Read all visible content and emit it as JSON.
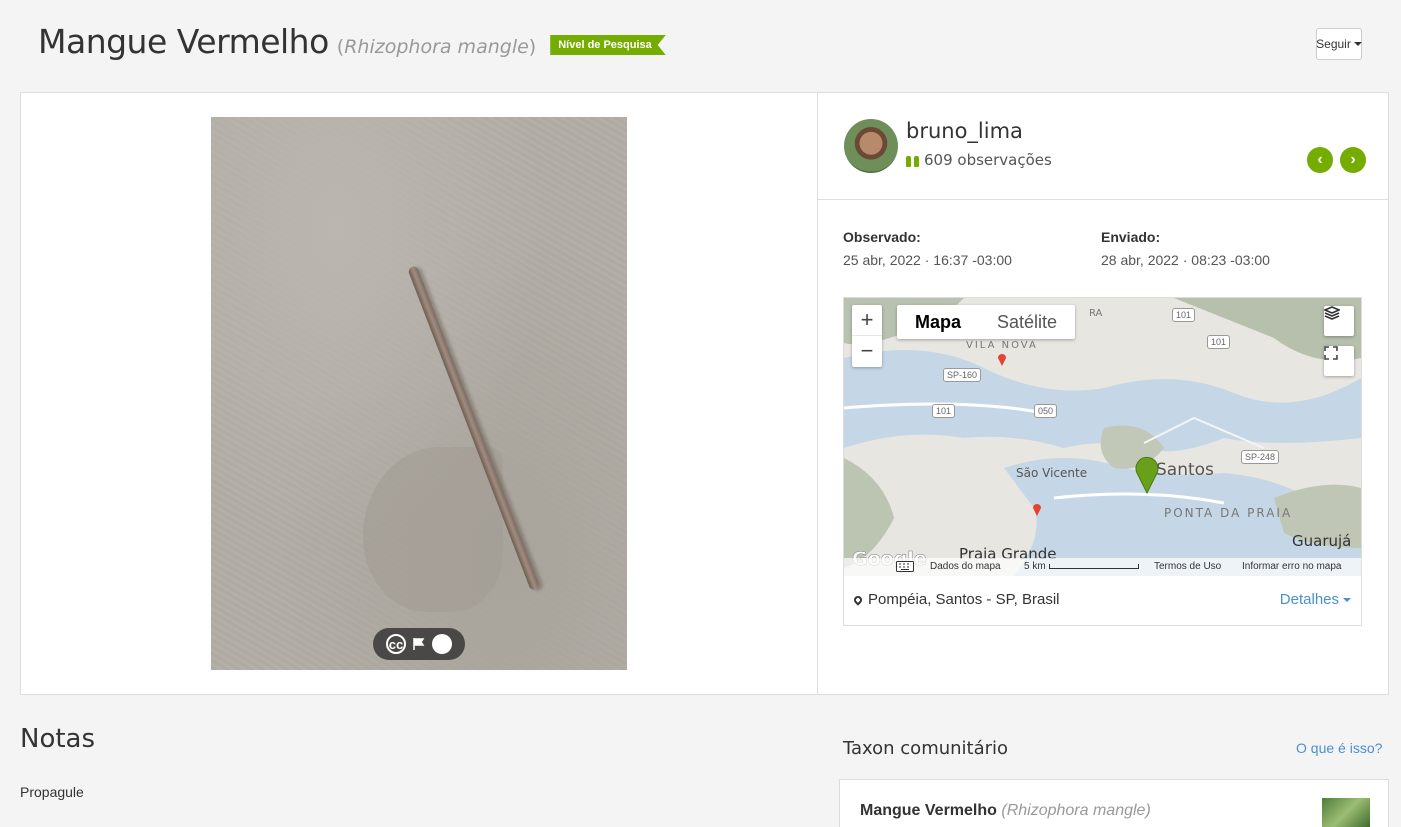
{
  "header": {
    "common_name": "Mangue Vermelho",
    "scientific_open": "(",
    "scientific_name": "Rhizophora mangle",
    "scientific_close": ")",
    "quality_badge": "Nível de Pesquisa",
    "follow_label": "Seguir"
  },
  "photo": {
    "icons": [
      "cc-license-icon",
      "flag-icon",
      "info-icon"
    ],
    "cc_text": "cc",
    "info_text": "i"
  },
  "observer": {
    "username": "bruno_lima",
    "observations": "609 observações",
    "prev_icon": "‹",
    "next_icon": "›"
  },
  "dates": {
    "observed_label": "Observado:",
    "observed_value": "25 abr, 2022 · 16:37 -03:00",
    "submitted_label": "Enviado:",
    "submitted_value": "28 abr, 2022 · 08:23 -03:00"
  },
  "map": {
    "type_map": "Mapa",
    "type_satellite": "Satélite",
    "zoom_in": "+",
    "zoom_out": "−",
    "labels": {
      "vila_nova": "VILA NOVA",
      "sao_vicente": "São Vicente",
      "santos": "Santos",
      "ponta_da_praia": "PONTA DA PRAIA",
      "guaruja": "Guarujá",
      "praia_grande": "Praia Grande",
      "ra": "RA"
    },
    "shields": {
      "sp160": "SP-160",
      "r101a": "101",
      "r101b": "101",
      "r101c": "101",
      "r050": "050",
      "sp248": "SP-248"
    },
    "google": "Google",
    "footer_data": "Dados do mapa",
    "footer_scale": "5 km",
    "footer_terms": "Termos de Uso",
    "footer_report": "Informar erro no mapa",
    "place": "Pompéia, Santos - SP, Brasil",
    "details": "Detalhes"
  },
  "notes": {
    "title": "Notas",
    "text": "Propagule"
  },
  "taxon": {
    "title": "Taxon comunitário",
    "what_link": "O que é isso?",
    "common_name": "Mangue Vermelho",
    "scientific_name": "(Rhizophora mangle)"
  },
  "colors": {
    "accent_green": "#74ac00",
    "link_blue": "#4a90d0"
  }
}
